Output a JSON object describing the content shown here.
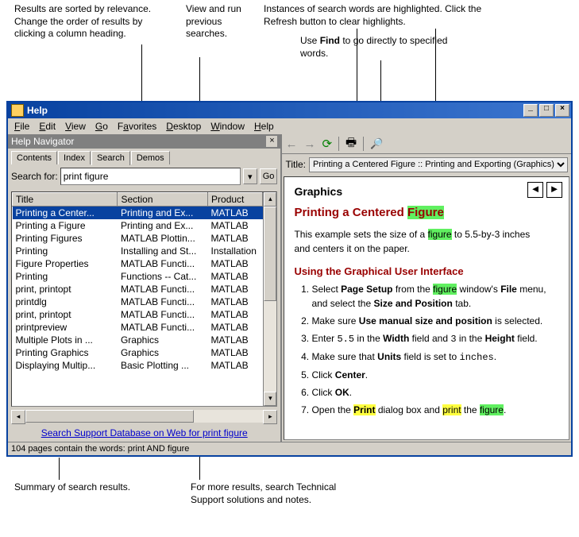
{
  "annotations": {
    "sort": "Results are sorted by relevance. Change the order of results by clicking a column heading.",
    "previous": "View and run previous searches.",
    "highlight": "Instances of search words are highlighted. Click the Refresh button to clear highlights.",
    "find": "Use Find to go directly to specified words.",
    "summary": "Summary of search results.",
    "support": "For more results, search Technical Support solutions and notes."
  },
  "window": {
    "title": "Help"
  },
  "menu": {
    "file": "File",
    "edit": "Edit",
    "view": "View",
    "go": "Go",
    "favorites": "Favorites",
    "desktop": "Desktop",
    "window": "Window",
    "help": "Help"
  },
  "nav": {
    "header": "Help Navigator",
    "tabs": {
      "contents": "Contents",
      "index": "Index",
      "search": "Search",
      "demos": "Demos"
    },
    "search_label": "Search for:",
    "search_value": "print figure",
    "go": "Go",
    "cols": {
      "title": "Title",
      "section": "Section",
      "product": "Product"
    },
    "rows": [
      {
        "t": "Printing a Center...",
        "s": "Printing and Ex...",
        "p": "MATLAB"
      },
      {
        "t": "Printing a Figure",
        "s": "Printing and Ex...",
        "p": "MATLAB"
      },
      {
        "t": "Printing Figures",
        "s": "MATLAB Plottin...",
        "p": "MATLAB"
      },
      {
        "t": "Printing",
        "s": "Installing and St...",
        "p": "Installation"
      },
      {
        "t": "Figure Properties",
        "s": "MATLAB Functi...",
        "p": "MATLAB"
      },
      {
        "t": "Printing",
        "s": "Functions -- Cat...",
        "p": "MATLAB"
      },
      {
        "t": "print, printopt",
        "s": "MATLAB Functi...",
        "p": "MATLAB"
      },
      {
        "t": "printdlg",
        "s": "MATLAB Functi...",
        "p": "MATLAB"
      },
      {
        "t": "print, printopt",
        "s": "MATLAB Functi...",
        "p": "MATLAB"
      },
      {
        "t": "printpreview",
        "s": "MATLAB Functi...",
        "p": "MATLAB"
      },
      {
        "t": "Multiple Plots in ...",
        "s": "Graphics",
        "p": "MATLAB"
      },
      {
        "t": "Printing Graphics",
        "s": "Graphics",
        "p": "MATLAB"
      },
      {
        "t": "Displaying Multip...",
        "s": "Basic Plotting ...",
        "p": "MATLAB"
      }
    ],
    "support_link": "Search Support Database on Web for print figure"
  },
  "status": "104 pages contain the words: print AND figure",
  "doc": {
    "title_label": "Title:",
    "title_value": "Printing a Centered Figure :: Printing and Exporting (Graphics)",
    "section": "Graphics",
    "h3a": "Printing a Centered ",
    "h3b": "Figure",
    "p1a": "This example sets the size of a ",
    "p1b": "figure",
    "p1c": " to 5.5-by-3 inches and centers it on the paper.",
    "h4": "Using the Graphical User Interface",
    "li1a": "Select ",
    "li1b": "Page Setup",
    "li1c": " from the ",
    "li1d": "figure",
    "li1e": " window's ",
    "li1f": "File",
    "li1g": " menu, and select the ",
    "li1h": "Size and Position",
    "li1i": " tab.",
    "li2a": "Make sure ",
    "li2b": "Use manual size and position",
    "li2c": " is selected.",
    "li3a": "Enter ",
    "li3b": "5.5",
    "li3c": " in the ",
    "li3d": "Width",
    "li3e": " field and ",
    "li3f": "3",
    "li3g": " in the ",
    "li3h": "Height",
    "li3i": " field.",
    "li4a": "Make sure that ",
    "li4b": "Units",
    "li4c": " field is set to ",
    "li4d": "inches",
    "li4e": ".",
    "li5a": "Click ",
    "li5b": "Center",
    "li5c": ".",
    "li6a": "Click ",
    "li6b": "OK",
    "li6c": ".",
    "li7a": "Open the ",
    "li7b": "Print",
    "li7c": " dialog box and ",
    "li7d": "print",
    "li7e": " the ",
    "li7f": "figure",
    "li7g": "."
  }
}
